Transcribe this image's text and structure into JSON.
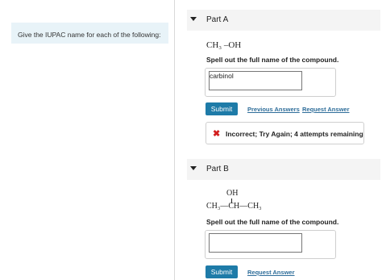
{
  "instruction": "Give the IUPAC name for each of the following:",
  "part_a": {
    "title": "Part A",
    "formula": "CH₃ –OH",
    "prompt": "Spell out the full name of the compound.",
    "answer_value": "carbinol",
    "submit_label": "Submit",
    "previous_answers_label": "Previous Answers",
    "request_answer_label": "Request Answer",
    "feedback_icon": "x-icon",
    "feedback_text": "Incorrect; Try Again; 4 attempts remaining",
    "feedback_color": "#d21f1f"
  },
  "part_b": {
    "title": "Part B",
    "formula_top": "OH",
    "formula_main": "CH₃—CH—CH₃",
    "prompt": "Spell out the full name of the compound.",
    "answer_value": "",
    "submit_label": "Submit",
    "request_answer_label": "Request Answer"
  },
  "colors": {
    "accent": "#1e7ba8",
    "link": "#2f6e9a",
    "instruction_bg": "#e8f3f8"
  }
}
